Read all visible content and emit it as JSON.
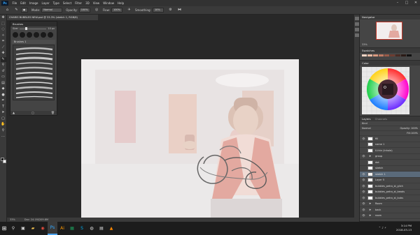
{
  "menu": {
    "logo": "Ps",
    "items": [
      "File",
      "Edit",
      "Image",
      "Layer",
      "Type",
      "Select",
      "Filter",
      "3D",
      "View",
      "Window",
      "Help"
    ]
  },
  "window_controls": {
    "minimize": "–",
    "maximize": "□",
    "close": "✕"
  },
  "options": {
    "mode_label": "Mode:",
    "mode_value": "Normal",
    "opacity_label": "Opacity:",
    "opacity_value": "100%",
    "flow_label": "Flow:",
    "flow_value": "100%",
    "smoothing_label": "Smoothing:",
    "smoothing_value": "10%"
  },
  "document": {
    "tab_title": "CHARIS BUBBLES NEW.psd @ 33.3% (sketch 1, RGB/8)"
  },
  "brushes_panel": {
    "title": "Brushes",
    "size_label": "Size:",
    "size_value": "10 px",
    "folder_name": "Brushes 1"
  },
  "navigator": {
    "title": "Navigator",
    "zoom": "33%"
  },
  "swatches": {
    "title": "Swatches"
  },
  "color_panel": {
    "title": "Color"
  },
  "layers_panel": {
    "tabs": [
      "Layers",
      "Channels"
    ],
    "kind_label": "Kind",
    "blend_mode": "Normal",
    "opacity_label": "Opacity:",
    "opacity_value": "100%",
    "fill_label": "Fill:",
    "fill_value": "100%",
    "layers": [
      {
        "name": "fill",
        "type": "layer"
      },
      {
        "name": "name 1",
        "type": "layer"
      },
      {
        "name": "Il-thin (Inhole)",
        "type": "layer"
      },
      {
        "name": "group",
        "type": "folder"
      },
      {
        "name": "dot",
        "type": "layer"
      },
      {
        "name": "sketch",
        "type": "layer"
      },
      {
        "name": "sketch 1",
        "type": "layer"
      },
      {
        "name": "Layer 5",
        "type": "layer"
      },
      {
        "name": "bubbles_petro_st_glich",
        "type": "layer"
      },
      {
        "name": "bubbles_petro_st_beads",
        "type": "layer"
      },
      {
        "name": "bubbles_petro_st_bubs",
        "type": "layer"
      },
      {
        "name": "Room",
        "type": "folder"
      },
      {
        "name": "back",
        "type": "folder"
      },
      {
        "name": "room",
        "type": "folder"
      }
    ]
  },
  "status": {
    "zoom": "33%",
    "doc_info": "Doc: 24.1M/209.8M"
  },
  "taskbar": {
    "start": "⊞",
    "apps": [
      "search",
      "task-view",
      "file-explorer",
      "chrome",
      "photoshop",
      "illustrator",
      "excel",
      "skype",
      "steam",
      "notepad",
      "vlc"
    ],
    "time": "3:14 PM",
    "date": "2018-03-13"
  },
  "colors": {
    "chrome_bg": "#2b2b2b",
    "panel_bg": "#454545",
    "canvas_bg": "#eeecec",
    "taskbar_accent": "#4aa3f0",
    "nav_frame": "#c0392b"
  }
}
